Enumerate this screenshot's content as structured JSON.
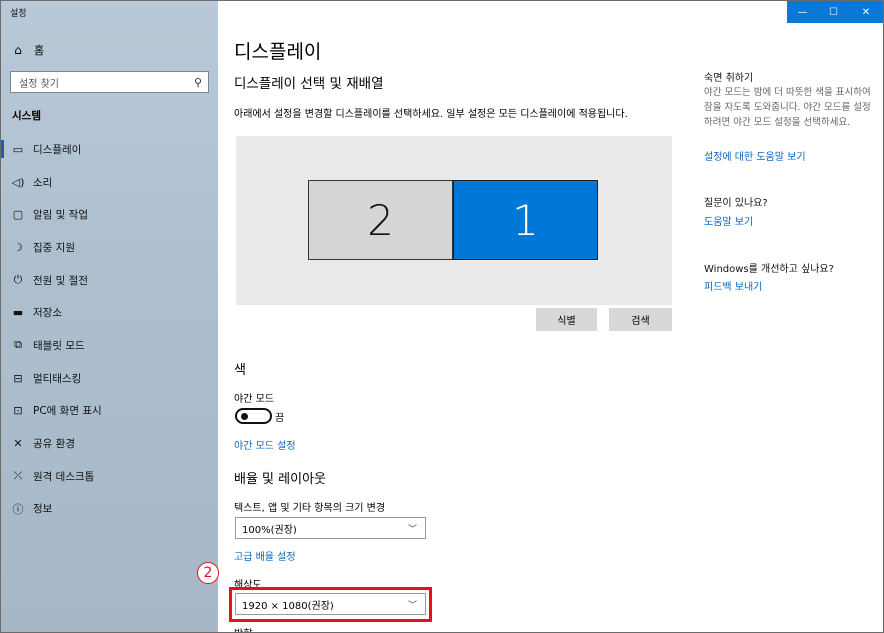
{
  "app": {
    "title": "설정"
  },
  "window_controls": {
    "minimize": "—",
    "maximize": "☐",
    "close": "✕"
  },
  "sidebar": {
    "home_label": "홈",
    "search_placeholder": "설정 찾기",
    "section_label": "시스템",
    "items": [
      {
        "label": "디스플레이",
        "icon": "monitor-icon",
        "glyph": "▭"
      },
      {
        "label": "소리",
        "icon": "speaker-icon",
        "glyph": "🔈"
      },
      {
        "label": "알림 및 작업",
        "icon": "notification-icon",
        "glyph": "▢"
      },
      {
        "label": "집중 지원",
        "icon": "moon-icon",
        "glyph": "☽"
      },
      {
        "label": "전원 및 절전",
        "icon": "power-icon",
        "glyph": "⏻"
      },
      {
        "label": "저장소",
        "icon": "storage-icon",
        "glyph": "▬"
      },
      {
        "label": "태블릿 모드",
        "icon": "tablet-icon",
        "glyph": "⧉"
      },
      {
        "label": "멀티태스킹",
        "icon": "multitasking-icon",
        "glyph": "⊟"
      },
      {
        "label": "PC에 화면 표시",
        "icon": "project-icon",
        "glyph": "⊡"
      },
      {
        "label": "공유 환경",
        "icon": "shared-icon",
        "glyph": "✕"
      },
      {
        "label": "원격 데스크톱",
        "icon": "remote-icon",
        "glyph": "⤫"
      },
      {
        "label": "정보",
        "icon": "info-icon",
        "glyph": "ⓘ"
      }
    ]
  },
  "main": {
    "title": "디스플레이",
    "select_section_title": "디스플레이 선택 및 재배열",
    "select_desc": "아래에서 설정을 변경할 디스플레이를 선택하세요. 일부 설정은 모든 디스플레이에 적용됩니다.",
    "monitors": {
      "left": "2",
      "right": "1"
    },
    "identify_button": "식별",
    "detect_button": "검색",
    "color_title": "색",
    "night_light_label": "야간 모드",
    "night_light_state": "끔",
    "night_light_link": "야간 모드 설정",
    "scale_title": "배율 및 레이아웃",
    "scale_label": "텍스트, 앱 및 기타 항목의 크기 변경",
    "scale_value": "100%(권장)",
    "advanced_scale_link": "고급 배율 설정",
    "resolution_label": "해상도",
    "resolution_value": "1920 × 1080(권장)",
    "orientation_label": "방향",
    "annotation_number": "2",
    "highlight_color": "#e8101a",
    "accent_color": "#0078d7"
  },
  "right_panel": {
    "sleep_title": "숙면 취하기",
    "sleep_text": "야간 모드는 밤에 더 따뜻한 색을 표시하여 잠을 자도록 도와줍니다. 야간 모드를 설정하려면 야간 모드 설정을 선택하세요.",
    "sleep_link": "설정에 대한 도움말 보기",
    "question_title": "질문이 있나요?",
    "help_link": "도움말 보기",
    "improve_title": "Windows를 개선하고 싶나요?",
    "feedback_link": "피드백 보내기"
  }
}
